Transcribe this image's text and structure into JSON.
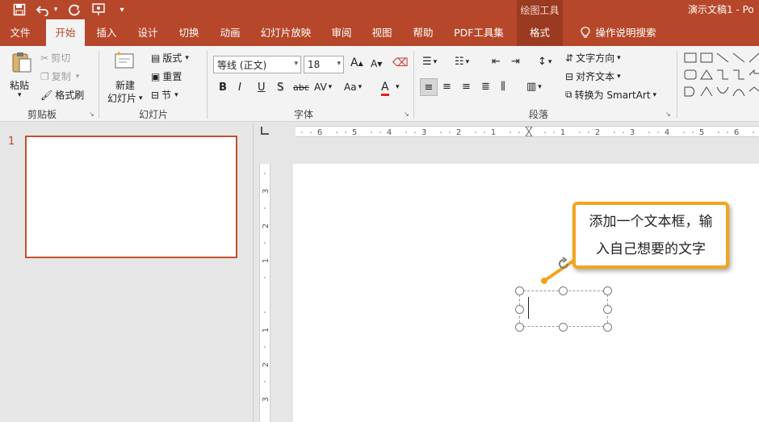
{
  "titlebar": {
    "context_header": "绘图工具",
    "document_title": "演示文稿1 - Po",
    "icons": [
      "save-icon",
      "undo-icon",
      "redo-icon",
      "present-from-start-icon",
      "customize-qat-icon"
    ]
  },
  "tabs": [
    {
      "label": "文件"
    },
    {
      "label": "开始",
      "active": true
    },
    {
      "label": "插入"
    },
    {
      "label": "设计"
    },
    {
      "label": "切换"
    },
    {
      "label": "动画"
    },
    {
      "label": "幻灯片放映"
    },
    {
      "label": "审阅"
    },
    {
      "label": "视图"
    },
    {
      "label": "帮助"
    },
    {
      "label": "PDF工具集"
    },
    {
      "label": "格式"
    },
    {
      "label": "操作说明搜索"
    }
  ],
  "ribbon": {
    "clipboard": {
      "paste": "粘贴",
      "cut": "剪切",
      "copy": "复制",
      "format_painter": "格式刷",
      "label": "剪贴板"
    },
    "slides": {
      "new_slide_line1": "新建",
      "new_slide_line2": "幻灯片",
      "layout": "版式",
      "reset": "重置",
      "section": "节",
      "label": "幻灯片"
    },
    "font": {
      "font_name": "等线 (正文)",
      "font_size": "18",
      "bold": "B",
      "italic": "I",
      "underline": "U",
      "shadow": "S",
      "strike": "abc",
      "spacing": "AV",
      "case": "Aa",
      "font_color": "A",
      "grow": "A",
      "shrink": "A",
      "label": "字体"
    },
    "paragraph": {
      "text_direction": "文字方向",
      "align_text": "对齐文本",
      "smartart": "转换为 SmartArt",
      "label": "段落"
    }
  },
  "slides_pane": {
    "slide_number": "1"
  },
  "rulers": {
    "h_ticks": [
      "6",
      "5",
      "4",
      "3",
      "2",
      "1",
      "0",
      "1",
      "2",
      "3",
      "4",
      "5",
      "6"
    ],
    "v_ticks": [
      "3",
      "2",
      "1",
      "0",
      "1",
      "2",
      "3"
    ]
  },
  "callout": {
    "line1": "添加一个文本框，输",
    "line2": "入自己想要的文字"
  },
  "colors": {
    "accent": "#b7472a",
    "callout_border": "#f2a51c"
  }
}
